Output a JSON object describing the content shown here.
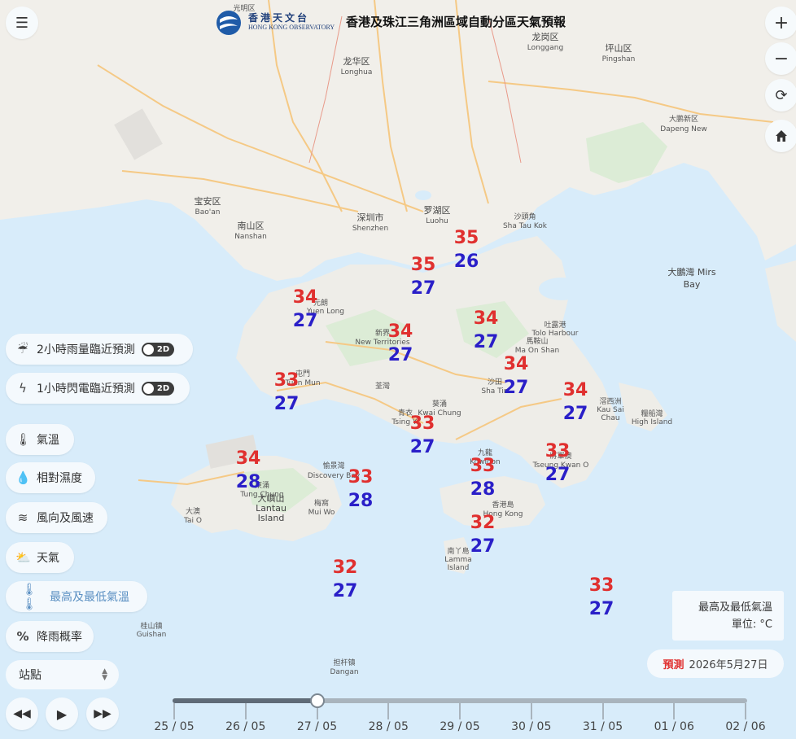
{
  "header": {
    "logo_chinese": "香港天文台",
    "logo_english": "HONG KONG OBSERVATORY",
    "title": "香港及珠江三角洲區域自動分區天氣預報"
  },
  "controls": {
    "menu_icon": "hamburger-menu-icon",
    "zoom_in": "+",
    "zoom_out": "−",
    "refresh_icon": "refresh-icon",
    "home_icon": "home-icon"
  },
  "layers": [
    {
      "id": "rain",
      "icon": "rain-cloud-icon",
      "label": "2小時雨量臨近預測",
      "toggle": "2D"
    },
    {
      "id": "lightning",
      "icon": "lightning-icon",
      "label": "1小時閃電臨近預測",
      "toggle": "2D"
    },
    {
      "id": "temperature",
      "icon": "thermometer-icon",
      "label": "氣溫"
    },
    {
      "id": "humidity",
      "icon": "droplet-icon",
      "label": "相對濕度"
    },
    {
      "id": "wind",
      "icon": "wind-icon",
      "label": "風向及風速"
    },
    {
      "id": "weather",
      "icon": "sun-cloud-icon",
      "label": "天氣"
    },
    {
      "id": "maxmin",
      "icon": "max-min-thermometer-icon",
      "label": "最高及最低氣溫",
      "active": true
    },
    {
      "id": "rainprob",
      "icon": "percent-icon",
      "label": "降雨概率"
    }
  ],
  "station_select": {
    "value": "站點"
  },
  "legend": {
    "title": "最高及最低氣溫",
    "unit": "單位: °C"
  },
  "forecast": {
    "label": "預測",
    "date": "2026年5月27日"
  },
  "playback": {
    "rewind_icon": "rewind-icon",
    "play_icon": "play-icon",
    "forward_icon": "fast-forward-icon"
  },
  "timeline": {
    "dates": [
      "25 / 05",
      "26 / 05",
      "27 / 05",
      "28 / 05",
      "29 / 05",
      "30 / 05",
      "31 / 05",
      "01 / 06",
      "02 / 06"
    ],
    "selected_index": 2
  },
  "stations": [
    {
      "hi": "35",
      "lo": "26"
    },
    {
      "hi": "35",
      "lo": "27"
    },
    {
      "hi": "34",
      "lo": "27"
    },
    {
      "hi": "34",
      "lo": "27"
    },
    {
      "hi": "34",
      "lo": "27"
    },
    {
      "hi": "34",
      "lo": "27"
    },
    {
      "hi": "33",
      "lo": "27"
    },
    {
      "hi": "34",
      "lo": "27"
    },
    {
      "hi": "33",
      "lo": "27"
    },
    {
      "hi": "33",
      "lo": "27"
    },
    {
      "hi": "34",
      "lo": "28"
    },
    {
      "hi": "33",
      "lo": "28"
    },
    {
      "hi": "33",
      "lo": "28"
    },
    {
      "hi": "32",
      "lo": "27"
    },
    {
      "hi": "32",
      "lo": "27"
    },
    {
      "hi": "33",
      "lo": "27"
    }
  ],
  "map_labels": [
    "光明区",
    "龙岗区",
    "Longgang",
    "坪山区",
    "Pingshan",
    "龙华区",
    "Longhua",
    "大鹏新区",
    "Dapeng New",
    "宝安区",
    "Bao'an",
    "南山区",
    "Nanshan",
    "深圳市",
    "Shenzhen",
    "罗湖区",
    "Luohu",
    "沙頭角",
    "Sha Tau Kok",
    "大鵬灣 Mirs",
    "Bay",
    "吐露港",
    "Tolo Harbour",
    "馬鞍山",
    "Ma On Shan",
    "沙田",
    "Sha Tin",
    "新界",
    "New Territories",
    "荃灣",
    "元朗",
    "Yuen Long",
    "屯門",
    "Tuen Mun",
    "青衣",
    "Tsing Yi",
    "葵涌",
    "Kwai Chung",
    "九龍",
    "Kowloon",
    "將軍澳",
    "Tseung Kwan O",
    "滘西洲",
    "Kau Sai",
    "Chau",
    "糧船灣",
    "High Island",
    "東涌",
    "Tung Chung",
    "愉景灣",
    "Discovery Bay",
    "大嶼山",
    "Lantau",
    "Island",
    "梅窩",
    "Mui Wo",
    "大澳",
    "Tai O",
    "香港島",
    "Hong Kong",
    "南丫島",
    "Lamma",
    "Island",
    "桂山镇",
    "Guishan",
    "担杆镇",
    "Dangan"
  ]
}
